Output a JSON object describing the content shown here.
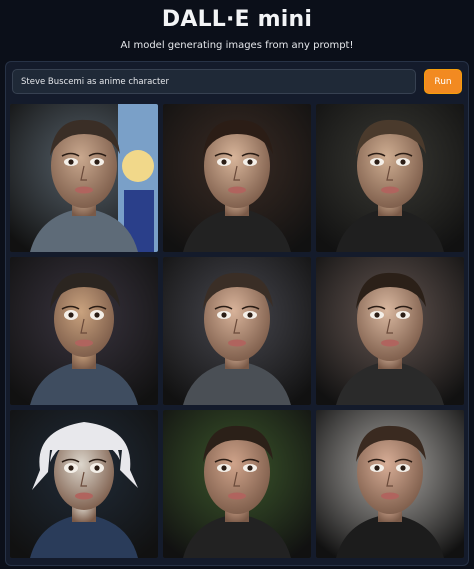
{
  "header": {
    "title": "DALL·E mini",
    "subtitle": "AI model generating images from any prompt!"
  },
  "prompt": {
    "value": "Steve Buscemi as anime character"
  },
  "run_label": "Run",
  "results": [
    {
      "bg": "#5a6670",
      "skin": "#c9a88e",
      "hair": "#3a2e26",
      "shirt": "#5e6b78",
      "style": "photo-anime"
    },
    {
      "bg": "#3b2a22",
      "skin": "#d8b59a",
      "hair": "#2b1d16",
      "shirt": "#222222",
      "style": "photo"
    },
    {
      "bg": "#3a3a34",
      "skin": "#cfae92",
      "hair": "#4a3a2c",
      "shirt": "#1f1f1f",
      "style": "photo"
    },
    {
      "bg": "#3a3440",
      "skin": "#c9a27e",
      "hair": "#2b2520",
      "shirt": "#3f4d60",
      "style": "anime"
    },
    {
      "bg": "#4a4a52",
      "skin": "#d8b39a",
      "hair": "#3a2e26",
      "shirt": "#4a4f55",
      "style": "photo"
    },
    {
      "bg": "#6a5a55",
      "skin": "#d9b8a0",
      "hair": "#2b2018",
      "shirt": "#2a2a2a",
      "style": "photo"
    },
    {
      "bg": "#1e2a38",
      "skin": "#dcd6cc",
      "hair": "#e8e8ec",
      "shirt": "#2a3c5a",
      "style": "anime"
    },
    {
      "bg": "#3c5a2a",
      "skin": "#cfa38a",
      "hair": "#2b2018",
      "shirt": "#222222",
      "style": "photo"
    },
    {
      "bg": "#b9b6b2",
      "skin": "#d7ad96",
      "hair": "#3a2a20",
      "shirt": "#1c1c1c",
      "style": "photo"
    }
  ]
}
